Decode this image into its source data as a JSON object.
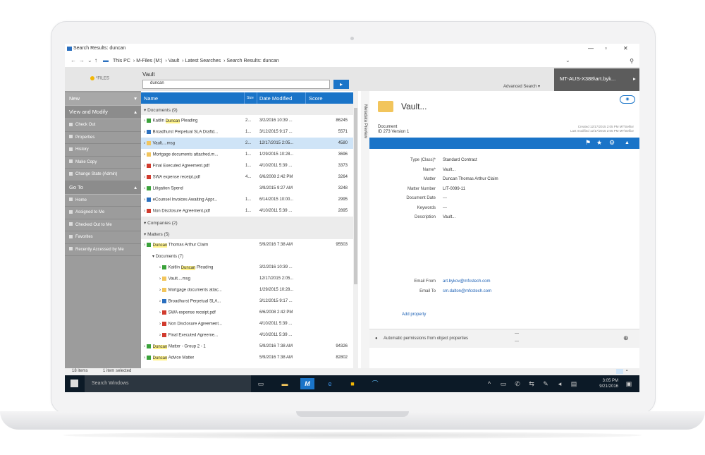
{
  "window": {
    "title": "Search Results: duncan"
  },
  "breadcrumb": [
    "This PC",
    "M-Files (M:)",
    "Vault",
    "Latest Searches",
    "Search Results: duncan"
  ],
  "app": {
    "logo_text": "*FILES",
    "vault_label": "Vault",
    "search_value": "duncan",
    "advanced_search": "Advanced Search ▾",
    "user": "MT-AUS-X388\\art.byk..."
  },
  "leftnav": {
    "new": "New",
    "view_modify": "View and Modify",
    "view_items": [
      "Check Out",
      "Properties",
      "History",
      "Make Copy",
      "Change State (Admin)"
    ],
    "goto": "Go To",
    "goto_items": [
      "Home",
      "Assigned to Me",
      "Checked Out to Me",
      "Favorites",
      "Recently Accessed by Me"
    ]
  },
  "list": {
    "columns": [
      "Name",
      "Size",
      "Date Modified",
      "Score"
    ],
    "groups": {
      "documents": "Documents (9)",
      "companies": "Companies (2)",
      "matters": "Matters (5)"
    },
    "documents": [
      {
        "pre": "Kaitlin ",
        "hl": "Duncan",
        "post": " Pleading",
        "size": "2...",
        "date": "3/2/2016 10:39 ...",
        "score": "86245",
        "icon": "green"
      },
      {
        "pre": "Broadhurst Perpetual SLA Draftd...",
        "hl": "",
        "post": "",
        "size": "1...",
        "date": "3/12/2015 9:17 ...",
        "score": "5571",
        "icon": "doc"
      },
      {
        "pre": "Vault....msg",
        "hl": "",
        "post": "",
        "size": "2...",
        "date": "12/17/2015 2:05...",
        "score": "4580",
        "icon": "mail"
      },
      {
        "pre": "Mortgage documents attached.m...",
        "hl": "",
        "post": "",
        "size": "1...",
        "date": "1/29/2015 10:28...",
        "score": "3696",
        "icon": "mail"
      },
      {
        "pre": "Final Executed Agreement.pdf",
        "hl": "",
        "post": "",
        "size": "1...",
        "date": "4/10/2011 5:39 ...",
        "score": "3373",
        "icon": "pdf"
      },
      {
        "pre": "SWA expense receipt.pdf",
        "hl": "",
        "post": "",
        "size": "4...",
        "date": "6/6/2008 2:42 PM",
        "score": "3264",
        "icon": "pdf"
      },
      {
        "pre": "Litigation Spend",
        "hl": "",
        "post": "",
        "size": "",
        "date": "3/9/2015 9:27 AM",
        "score": "3248",
        "icon": "green"
      },
      {
        "pre": "eCounsel Invoices Awaiting Appr...",
        "hl": "",
        "post": "",
        "size": "1...",
        "date": "6/14/2015 10:00...",
        "score": "2995",
        "icon": "doc"
      },
      {
        "pre": "Non Disclosure Agreement.pdf",
        "hl": "",
        "post": "",
        "size": "1...",
        "date": "4/10/2011 5:39 ...",
        "score": "2895",
        "icon": "pdf"
      }
    ],
    "matter": {
      "pre": "",
      "hl": "Duncan",
      "post": " Thomas Arthur Claim",
      "date": "5/9/2016 7:38 AM",
      "score": "95503"
    },
    "subgroup": "Documents (7)",
    "matter_docs": [
      {
        "pre": "Kaitlin ",
        "hl": "Duncan",
        "post": " Pleading",
        "date": "3/2/2016 10:39 ...",
        "icon": "green"
      },
      {
        "pre": "Vault....msg",
        "hl": "",
        "post": "",
        "date": "12/17/2015 2:05...",
        "icon": "mail"
      },
      {
        "pre": "Mortgage documents attac...",
        "hl": "",
        "post": "",
        "date": "1/29/2015 10:28...",
        "icon": "mail"
      },
      {
        "pre": "Broadhurst Perpetual SLA...",
        "hl": "",
        "post": "",
        "date": "3/12/2015 9:17 ...",
        "icon": "doc"
      },
      {
        "pre": "SWA expense receipt.pdf",
        "hl": "",
        "post": "",
        "date": "6/6/2008 2:42 PM",
        "icon": "pdf"
      },
      {
        "pre": "Non Disclosure Agreement...",
        "hl": "",
        "post": "",
        "date": "4/10/2011 5:39 ...",
        "icon": "pdf"
      },
      {
        "pre": "Final Executed Agreeme...",
        "hl": "",
        "post": "",
        "date": "4/10/2011 5:39 ...",
        "icon": "pdf"
      }
    ],
    "more_matters": [
      {
        "pre": "",
        "hl": "Duncan",
        "post": " Matter - Group 2 - 1",
        "date": "5/9/2016 7:38 AM",
        "score": "94326"
      },
      {
        "pre": "",
        "hl": "Duncan",
        "post": " Advice Matter",
        "date": "5/9/2016 7:38 AM",
        "score": "82802"
      }
    ]
  },
  "metadata_tab": "Metadata Preview",
  "right": {
    "title": "Vault...",
    "subtitle1": "Document",
    "subtitle2": "ID 273 Version 1",
    "created": "Created 12/17/2015 2:05 PM MT\\Sellior",
    "modified": "Last modified 12/17/2015 2:05 PM MT\\Sellior",
    "props": [
      {
        "label": "Type (Class)*",
        "value": "Standard Contract"
      },
      {
        "label": "Name*",
        "value": "Vault..."
      },
      {
        "label": "Matter",
        "value": "Duncan Thomas Arthur Claim"
      },
      {
        "label": "Matter Number",
        "value": "LIT-0099-11"
      },
      {
        "label": "Document Date",
        "value": "---"
      },
      {
        "label": "Keywords",
        "value": "---"
      },
      {
        "label": "Description",
        "value": "Vault..."
      }
    ],
    "email_from_label": "Email From",
    "email_from": "art.bykov@mfcstech.com",
    "email_to_label": "Email To",
    "email_to": "sm.dalton@mfcstech.com",
    "add_property": "Add property",
    "permissions": "Automatic permissions from object properties",
    "perm_dots": "---"
  },
  "status": {
    "items": "18 items",
    "selected": "1 item selected"
  },
  "taskbar": {
    "search": "Search Windows",
    "time": "3:05 PM",
    "date": "9/21/2016"
  }
}
